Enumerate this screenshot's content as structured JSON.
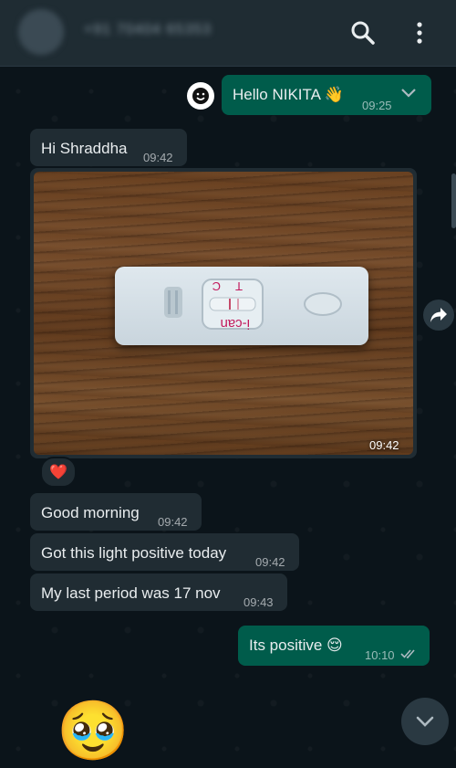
{
  "header": {
    "contact": "+91 70404 65353"
  },
  "messages": [
    {
      "id": "m1",
      "text": "Hello NIKITA 👋",
      "time": "09:25",
      "dir": "out"
    },
    {
      "id": "m2",
      "text": "Hi Shraddha",
      "time": "09:42",
      "dir": "in"
    },
    {
      "id": "m3",
      "type": "image",
      "time": "09:42",
      "dir": "in",
      "reaction": "❤️",
      "photo_text": [
        "C",
        "T",
        "i-can"
      ]
    },
    {
      "id": "m4",
      "text": "Good morning",
      "time": "09:42",
      "dir": "in"
    },
    {
      "id": "m5",
      "text": "Got this light positive today",
      "time": "09:42",
      "dir": "in"
    },
    {
      "id": "m6",
      "text": "My last period was 17 nov",
      "time": "09:43",
      "dir": "in"
    },
    {
      "id": "m7",
      "text": "Its positive 😌",
      "time": "10:10",
      "dir": "out",
      "status": "read"
    },
    {
      "id": "m8",
      "text": "🥹",
      "dir": "in"
    }
  ],
  "colors": {
    "background": "#0b141a",
    "incoming": "#202c33",
    "outgoing": "#005c4b",
    "header": "#1f2c33"
  },
  "icons": [
    "search-icon",
    "menu-icon",
    "smiley-icon",
    "chevron-down-icon",
    "heart-icon",
    "forward-icon",
    "double-check-icon",
    "scroll-down-icon"
  ]
}
